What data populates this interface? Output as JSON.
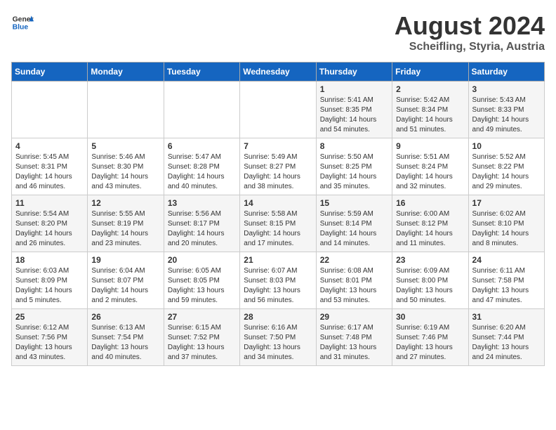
{
  "header": {
    "logo_general": "General",
    "logo_blue": "Blue",
    "month_year": "August 2024",
    "location": "Scheifling, Styria, Austria"
  },
  "weekdays": [
    "Sunday",
    "Monday",
    "Tuesday",
    "Wednesday",
    "Thursday",
    "Friday",
    "Saturday"
  ],
  "weeks": [
    [
      {
        "day": "",
        "info": ""
      },
      {
        "day": "",
        "info": ""
      },
      {
        "day": "",
        "info": ""
      },
      {
        "day": "",
        "info": ""
      },
      {
        "day": "1",
        "info": "Sunrise: 5:41 AM\nSunset: 8:35 PM\nDaylight: 14 hours\nand 54 minutes."
      },
      {
        "day": "2",
        "info": "Sunrise: 5:42 AM\nSunset: 8:34 PM\nDaylight: 14 hours\nand 51 minutes."
      },
      {
        "day": "3",
        "info": "Sunrise: 5:43 AM\nSunset: 8:33 PM\nDaylight: 14 hours\nand 49 minutes."
      }
    ],
    [
      {
        "day": "4",
        "info": "Sunrise: 5:45 AM\nSunset: 8:31 PM\nDaylight: 14 hours\nand 46 minutes."
      },
      {
        "day": "5",
        "info": "Sunrise: 5:46 AM\nSunset: 8:30 PM\nDaylight: 14 hours\nand 43 minutes."
      },
      {
        "day": "6",
        "info": "Sunrise: 5:47 AM\nSunset: 8:28 PM\nDaylight: 14 hours\nand 40 minutes."
      },
      {
        "day": "7",
        "info": "Sunrise: 5:49 AM\nSunset: 8:27 PM\nDaylight: 14 hours\nand 38 minutes."
      },
      {
        "day": "8",
        "info": "Sunrise: 5:50 AM\nSunset: 8:25 PM\nDaylight: 14 hours\nand 35 minutes."
      },
      {
        "day": "9",
        "info": "Sunrise: 5:51 AM\nSunset: 8:24 PM\nDaylight: 14 hours\nand 32 minutes."
      },
      {
        "day": "10",
        "info": "Sunrise: 5:52 AM\nSunset: 8:22 PM\nDaylight: 14 hours\nand 29 minutes."
      }
    ],
    [
      {
        "day": "11",
        "info": "Sunrise: 5:54 AM\nSunset: 8:20 PM\nDaylight: 14 hours\nand 26 minutes."
      },
      {
        "day": "12",
        "info": "Sunrise: 5:55 AM\nSunset: 8:19 PM\nDaylight: 14 hours\nand 23 minutes."
      },
      {
        "day": "13",
        "info": "Sunrise: 5:56 AM\nSunset: 8:17 PM\nDaylight: 14 hours\nand 20 minutes."
      },
      {
        "day": "14",
        "info": "Sunrise: 5:58 AM\nSunset: 8:15 PM\nDaylight: 14 hours\nand 17 minutes."
      },
      {
        "day": "15",
        "info": "Sunrise: 5:59 AM\nSunset: 8:14 PM\nDaylight: 14 hours\nand 14 minutes."
      },
      {
        "day": "16",
        "info": "Sunrise: 6:00 AM\nSunset: 8:12 PM\nDaylight: 14 hours\nand 11 minutes."
      },
      {
        "day": "17",
        "info": "Sunrise: 6:02 AM\nSunset: 8:10 PM\nDaylight: 14 hours\nand 8 minutes."
      }
    ],
    [
      {
        "day": "18",
        "info": "Sunrise: 6:03 AM\nSunset: 8:09 PM\nDaylight: 14 hours\nand 5 minutes."
      },
      {
        "day": "19",
        "info": "Sunrise: 6:04 AM\nSunset: 8:07 PM\nDaylight: 14 hours\nand 2 minutes."
      },
      {
        "day": "20",
        "info": "Sunrise: 6:05 AM\nSunset: 8:05 PM\nDaylight: 13 hours\nand 59 minutes."
      },
      {
        "day": "21",
        "info": "Sunrise: 6:07 AM\nSunset: 8:03 PM\nDaylight: 13 hours\nand 56 minutes."
      },
      {
        "day": "22",
        "info": "Sunrise: 6:08 AM\nSunset: 8:01 PM\nDaylight: 13 hours\nand 53 minutes."
      },
      {
        "day": "23",
        "info": "Sunrise: 6:09 AM\nSunset: 8:00 PM\nDaylight: 13 hours\nand 50 minutes."
      },
      {
        "day": "24",
        "info": "Sunrise: 6:11 AM\nSunset: 7:58 PM\nDaylight: 13 hours\nand 47 minutes."
      }
    ],
    [
      {
        "day": "25",
        "info": "Sunrise: 6:12 AM\nSunset: 7:56 PM\nDaylight: 13 hours\nand 43 minutes."
      },
      {
        "day": "26",
        "info": "Sunrise: 6:13 AM\nSunset: 7:54 PM\nDaylight: 13 hours\nand 40 minutes."
      },
      {
        "day": "27",
        "info": "Sunrise: 6:15 AM\nSunset: 7:52 PM\nDaylight: 13 hours\nand 37 minutes."
      },
      {
        "day": "28",
        "info": "Sunrise: 6:16 AM\nSunset: 7:50 PM\nDaylight: 13 hours\nand 34 minutes."
      },
      {
        "day": "29",
        "info": "Sunrise: 6:17 AM\nSunset: 7:48 PM\nDaylight: 13 hours\nand 31 minutes."
      },
      {
        "day": "30",
        "info": "Sunrise: 6:19 AM\nSunset: 7:46 PM\nDaylight: 13 hours\nand 27 minutes."
      },
      {
        "day": "31",
        "info": "Sunrise: 6:20 AM\nSunset: 7:44 PM\nDaylight: 13 hours\nand 24 minutes."
      }
    ]
  ]
}
